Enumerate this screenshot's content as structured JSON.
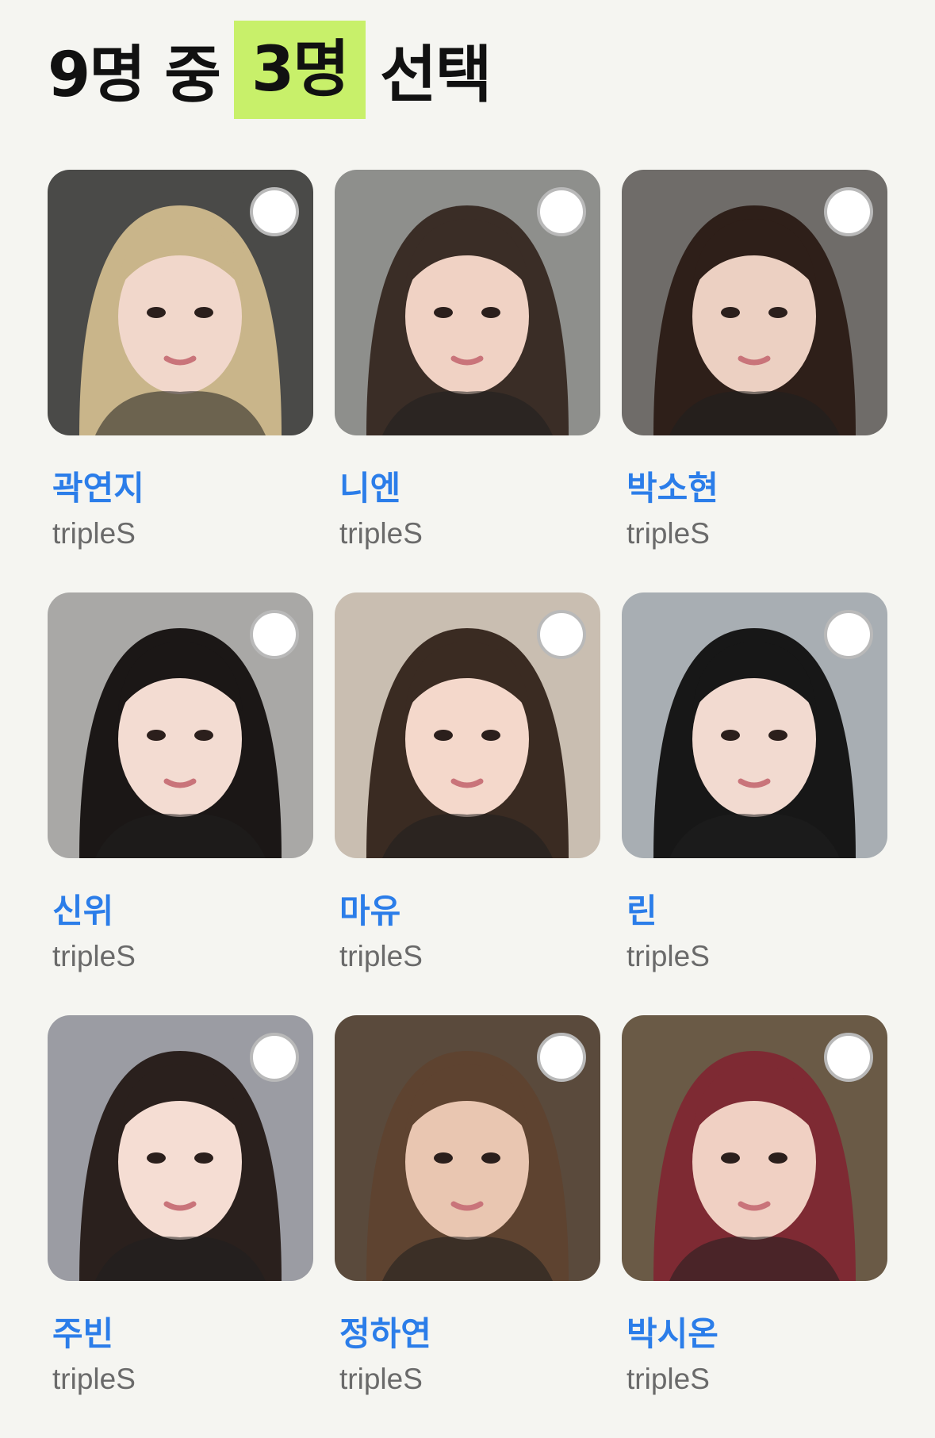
{
  "header": {
    "prefix": "9명 중",
    "highlight": "3명",
    "suffix": "선택"
  },
  "members": [
    {
      "name": "곽연지",
      "group": "tripleS",
      "bg": "#4a4a48",
      "hair": "#c9b58a",
      "skin": "#f1d7cb"
    },
    {
      "name": "니엔",
      "group": "tripleS",
      "bg": "#8e8f8c",
      "hair": "#3a2d26",
      "skin": "#f0d2c4"
    },
    {
      "name": "박소현",
      "group": "tripleS",
      "bg": "#6f6c69",
      "hair": "#2e1f19",
      "skin": "#ecd0c2"
    },
    {
      "name": "신위",
      "group": "tripleS",
      "bg": "#a9a8a6",
      "hair": "#1b1716",
      "skin": "#f3dcd2"
    },
    {
      "name": "마유",
      "group": "tripleS",
      "bg": "#c9beb1",
      "hair": "#3a2b22",
      "skin": "#f4d8cb"
    },
    {
      "name": "린",
      "group": "tripleS",
      "bg": "#a8aeb3",
      "hair": "#171717",
      "skin": "#f2dad0"
    },
    {
      "name": "주빈",
      "group": "tripleS",
      "bg": "#9b9ca3",
      "hair": "#2a201d",
      "skin": "#f5ddd3"
    },
    {
      "name": "정하연",
      "group": "tripleS",
      "bg": "#5a4a3c",
      "hair": "#5e4330",
      "skin": "#e9c6b1"
    },
    {
      "name": "박시온",
      "group": "tripleS",
      "bg": "#6a5a46",
      "hair": "#7e2a33",
      "skin": "#f0d0c3"
    }
  ]
}
